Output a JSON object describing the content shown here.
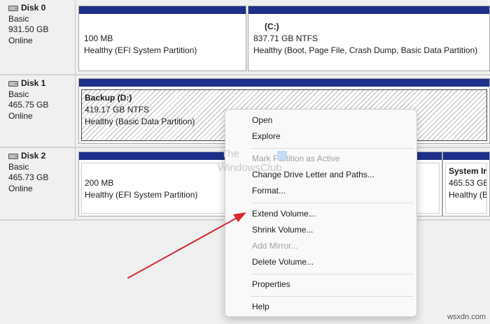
{
  "disks": [
    {
      "name": "Disk 0",
      "type": "Basic",
      "size": "931.50 GB",
      "status": "Online",
      "partitions": [
        {
          "title": "",
          "size": "100 MB",
          "status": "Healthy (EFI System Partition)"
        },
        {
          "title": "(C:)",
          "size": "837.71 GB NTFS",
          "status": "Healthy (Boot, Page File, Crash Dump, Basic Data Partition)"
        }
      ]
    },
    {
      "name": "Disk 1",
      "type": "Basic",
      "size": "465.75 GB",
      "status": "Online",
      "partitions": [
        {
          "title": "Backup  (D:)",
          "size": "419.17 GB NTFS",
          "status": "Healthy (Basic Data Partition)"
        }
      ]
    },
    {
      "name": "Disk 2",
      "type": "Basic",
      "size": "465.73 GB",
      "status": "Online",
      "partitions": [
        {
          "title": "",
          "size": "200 MB",
          "status": "Healthy (EFI System Partition)"
        },
        {
          "title": "System Im",
          "size": "465.53 GB N",
          "status": "Healthy (B"
        }
      ]
    }
  ],
  "context_menu": {
    "items": [
      {
        "label": "Open",
        "enabled": true
      },
      {
        "label": "Explore",
        "enabled": true
      },
      {
        "label": "Mark Partition as Active",
        "enabled": false
      },
      {
        "label": "Change Drive Letter and Paths...",
        "enabled": true
      },
      {
        "label": "Format...",
        "enabled": true
      },
      {
        "label": "Extend Volume...",
        "enabled": true
      },
      {
        "label": "Shrink Volume...",
        "enabled": true
      },
      {
        "label": "Add Mirror...",
        "enabled": false
      },
      {
        "label": "Delete Volume...",
        "enabled": true
      },
      {
        "label": "Properties",
        "enabled": true
      },
      {
        "label": "Help",
        "enabled": true
      }
    ]
  },
  "watermark": {
    "line1": "The",
    "line2": "WindowsClub"
  },
  "site_mark": "wsxdn.com",
  "colors": {
    "partition_bar": "#1c2f8a",
    "arrow": "#d9282f",
    "background": "#f0f0f0"
  },
  "icons": {
    "disk": "hard-disk-icon",
    "arrow": "red-pointer-arrow"
  }
}
